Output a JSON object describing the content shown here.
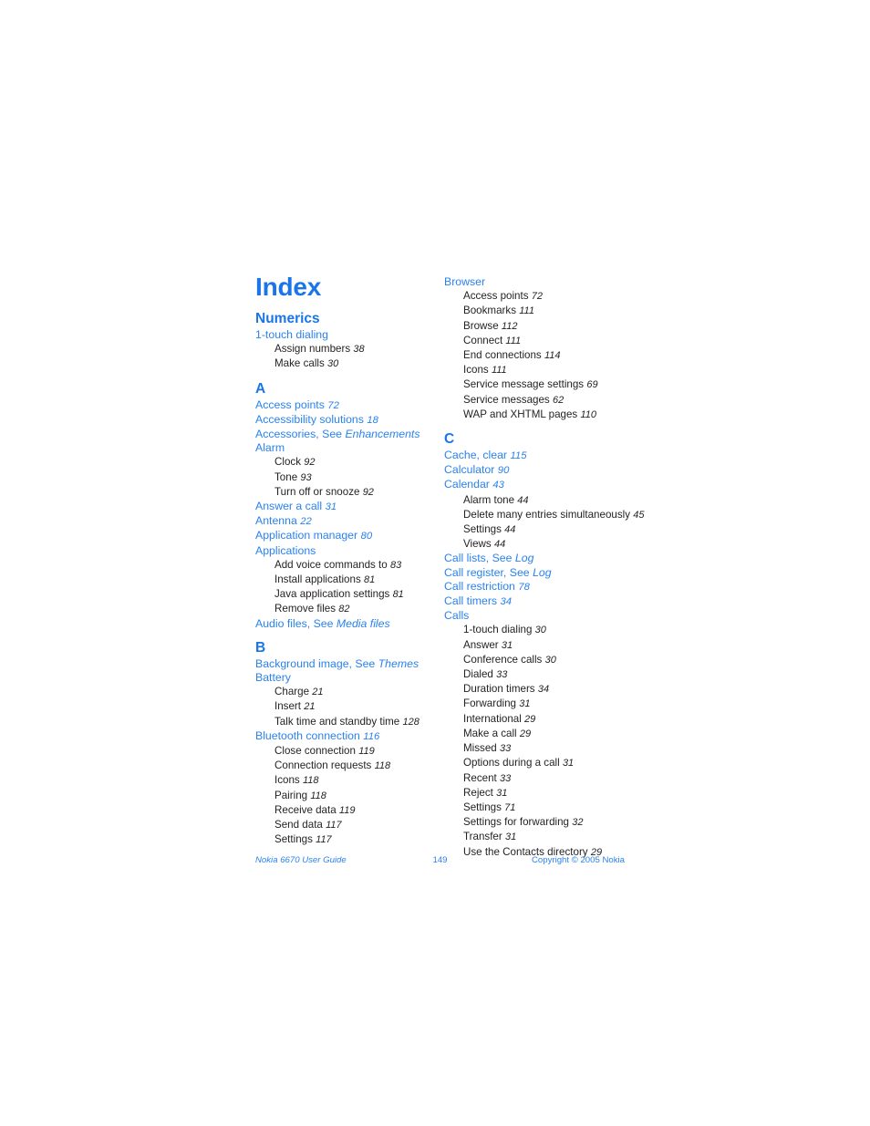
{
  "document": {
    "title": "Index",
    "colors": {
      "link_blue": "#2a82ef",
      "heading_blue": "#1a75e8",
      "body_text": "#231f20",
      "page_background": "#ffffff"
    }
  },
  "footer": {
    "guide_name": "Nokia 6670 User Guide",
    "page_number": "149",
    "copyright": "Copyright © 2005 Nokia"
  },
  "columns": {
    "left": [
      {
        "letter": "Numerics",
        "entries": [
          {
            "text": "1-touch dialing",
            "page": "",
            "xref": "",
            "subs": [
              {
                "text": "Assign numbers",
                "page": "38"
              },
              {
                "text": "Make calls",
                "page": "30"
              }
            ]
          }
        ]
      },
      {
        "letter": "A",
        "entries": [
          {
            "text": "Access points",
            "page": "72",
            "xref": "",
            "subs": []
          },
          {
            "text": "Accessibility solutions",
            "page": "18",
            "xref": "",
            "subs": []
          },
          {
            "text": "Accessories, See",
            "page": "",
            "xref": "Enhancements",
            "subs": []
          },
          {
            "text": "Alarm",
            "page": "",
            "xref": "",
            "subs": [
              {
                "text": "Clock",
                "page": "92"
              },
              {
                "text": "Tone",
                "page": "93"
              },
              {
                "text": "Turn off or snooze",
                "page": "92"
              }
            ]
          },
          {
            "text": "Answer a call",
            "page": "31",
            "xref": "",
            "subs": []
          },
          {
            "text": "Antenna",
            "page": "22",
            "xref": "",
            "subs": []
          },
          {
            "text": "Application manager",
            "page": "80",
            "xref": "",
            "subs": []
          },
          {
            "text": "Applications",
            "page": "",
            "xref": "",
            "subs": [
              {
                "text": "Add voice commands to",
                "page": "83"
              },
              {
                "text": "Install applications",
                "page": "81"
              },
              {
                "text": "Java application settings",
                "page": "81"
              },
              {
                "text": "Remove files",
                "page": "82"
              }
            ]
          },
          {
            "text": "Audio files, See",
            "page": "",
            "xref": "Media files",
            "subs": []
          }
        ]
      },
      {
        "letter": "B",
        "entries": [
          {
            "text": "Background image, See",
            "page": "",
            "xref": "Themes",
            "subs": []
          },
          {
            "text": "Battery",
            "page": "",
            "xref": "",
            "subs": [
              {
                "text": "Charge",
                "page": "21"
              },
              {
                "text": "Insert",
                "page": "21"
              },
              {
                "text": "Talk time and standby time",
                "page": "128"
              }
            ]
          },
          {
            "text": "Bluetooth connection",
            "page": "116",
            "xref": "",
            "subs": [
              {
                "text": "Close connection",
                "page": "119"
              },
              {
                "text": "Connection requests",
                "page": "118"
              },
              {
                "text": "Icons",
                "page": "118"
              },
              {
                "text": "Pairing",
                "page": "118"
              },
              {
                "text": "Receive data",
                "page": "119"
              },
              {
                "text": "Send data",
                "page": "117"
              },
              {
                "text": "Settings",
                "page": "117"
              }
            ]
          }
        ]
      }
    ],
    "right": [
      {
        "letter": "",
        "entries": [
          {
            "text": "Browser",
            "page": "",
            "xref": "",
            "subs": [
              {
                "text": "Access points",
                "page": "72"
              },
              {
                "text": "Bookmarks",
                "page": "111"
              },
              {
                "text": "Browse",
                "page": "112"
              },
              {
                "text": "Connect",
                "page": "111"
              },
              {
                "text": "End connections",
                "page": "114"
              },
              {
                "text": "Icons",
                "page": "111"
              },
              {
                "text": "Service message settings",
                "page": "69"
              },
              {
                "text": "Service messages",
                "page": "62"
              },
              {
                "text": "WAP and XHTML pages",
                "page": "110"
              }
            ]
          }
        ]
      },
      {
        "letter": "C",
        "entries": [
          {
            "text": "Cache, clear",
            "page": "115",
            "xref": "",
            "subs": []
          },
          {
            "text": "Calculator",
            "page": "90",
            "xref": "",
            "subs": []
          },
          {
            "text": "Calendar",
            "page": "43",
            "xref": "",
            "subs": [
              {
                "text": "Alarm tone",
                "page": "44"
              },
              {
                "text": "Delete many entries simultaneously",
                "page": "45"
              },
              {
                "text": "Settings",
                "page": "44"
              },
              {
                "text": "Views",
                "page": "44"
              }
            ]
          },
          {
            "text": "Call lists, See",
            "page": "",
            "xref": "Log",
            "subs": []
          },
          {
            "text": "Call register, See",
            "page": "",
            "xref": "Log",
            "subs": []
          },
          {
            "text": "Call restriction",
            "page": "78",
            "xref": "",
            "subs": []
          },
          {
            "text": "Call timers",
            "page": "34",
            "xref": "",
            "subs": []
          },
          {
            "text": "Calls",
            "page": "",
            "xref": "",
            "subs": [
              {
                "text": "1-touch dialing",
                "page": "30"
              },
              {
                "text": "Answer",
                "page": "31"
              },
              {
                "text": "Conference calls",
                "page": "30"
              },
              {
                "text": "Dialed",
                "page": "33"
              },
              {
                "text": "Duration timers",
                "page": "34"
              },
              {
                "text": "Forwarding",
                "page": "31"
              },
              {
                "text": "International",
                "page": "29"
              },
              {
                "text": "Make a call",
                "page": "29"
              },
              {
                "text": "Missed",
                "page": "33"
              },
              {
                "text": "Options during a call",
                "page": "31"
              },
              {
                "text": "Recent",
                "page": "33"
              },
              {
                "text": "Reject",
                "page": "31"
              },
              {
                "text": "Settings",
                "page": "71"
              },
              {
                "text": "Settings for forwarding",
                "page": "32"
              },
              {
                "text": "Transfer",
                "page": "31"
              },
              {
                "text": "Use the Contacts directory",
                "page": "29"
              }
            ]
          }
        ]
      }
    ]
  }
}
